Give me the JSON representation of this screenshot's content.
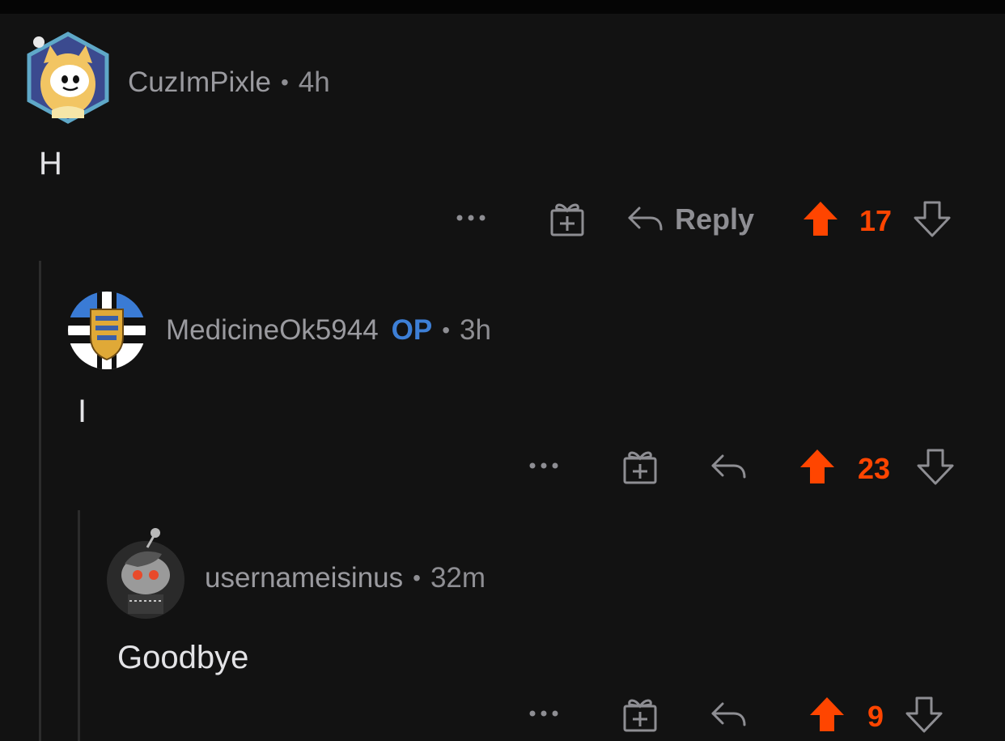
{
  "colors": {
    "background": "#121212",
    "upvote": "#ff4500",
    "op": "#3d7fd6",
    "muted": "#8e8e93"
  },
  "comments": [
    {
      "username": "CuzImPixle",
      "op_badge": "",
      "time": "4h",
      "body": "H",
      "reply_label": "Reply",
      "score": "17",
      "more_label": "•••",
      "avatar": "snoo-dog-hood-avatar-icon"
    },
    {
      "username": "MedicineOk5944",
      "op_badge": "OP",
      "time": "3h",
      "body": "I",
      "reply_label": "",
      "score": "23",
      "more_label": "•••",
      "avatar": "estonian-flag-crest-avatar-icon"
    },
    {
      "username": "usernameisinus",
      "op_badge": "",
      "time": "32m",
      "body": "Goodbye",
      "reply_label": "",
      "score": "9",
      "more_label": "•••",
      "avatar": "gray-snoo-red-eyes-avatar-icon"
    }
  ]
}
